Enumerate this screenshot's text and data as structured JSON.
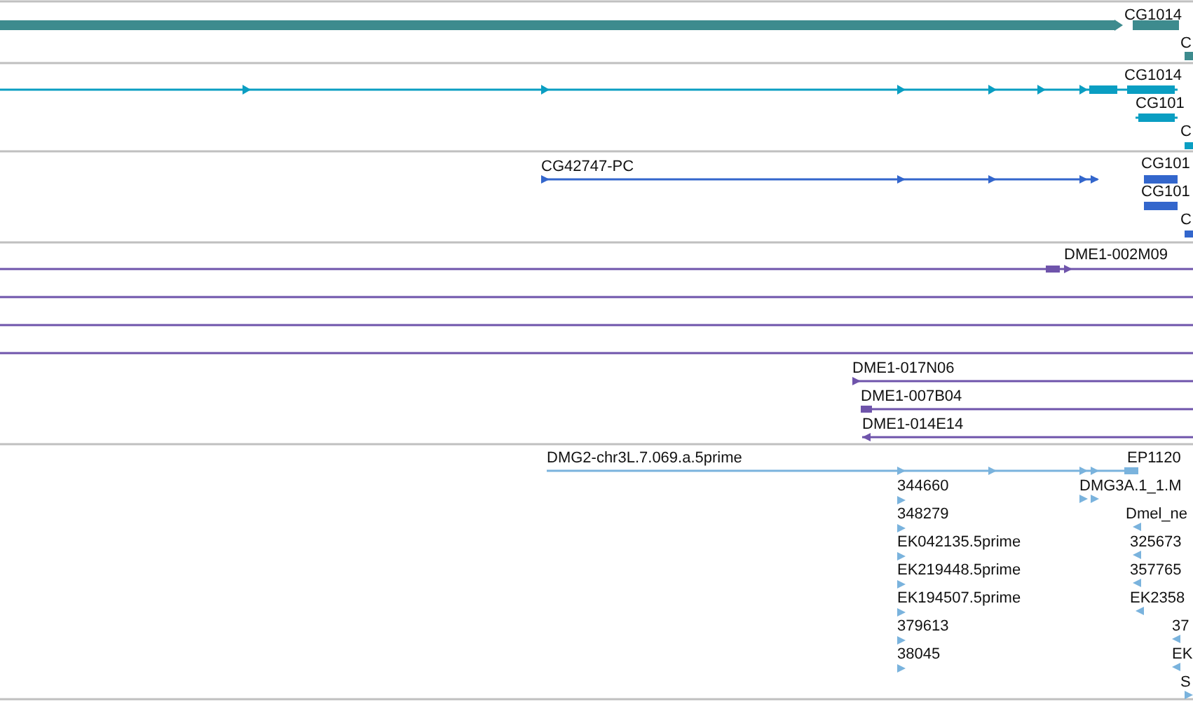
{
  "tracks": [
    {
      "color": "#3d8b8e",
      "features": [
        {
          "label": "CG1014"
        },
        {
          "label": "C"
        }
      ]
    },
    {
      "color": "#0a9ec2",
      "features": [
        {
          "label": "CG1014"
        },
        {
          "label": "CG101"
        },
        {
          "label": "C"
        }
      ]
    },
    {
      "color": "#3366cc",
      "features": [
        {
          "label": "CG42747-PC"
        },
        {
          "label": "CG101"
        },
        {
          "label": "CG101"
        },
        {
          "label": "C"
        }
      ]
    },
    {
      "color": "#6f54ab",
      "features": [
        {
          "kind": "clone",
          "label": "DME1-002M09"
        },
        {
          "kind": "line"
        },
        {
          "kind": "line"
        },
        {
          "kind": "line"
        },
        {
          "kind": "clone",
          "label": "DME1-017N06"
        },
        {
          "kind": "clone",
          "label": "DME1-007B04"
        },
        {
          "kind": "clone",
          "label": "DME1-014E14"
        }
      ]
    },
    {
      "color": "#7ab3dd",
      "features": [
        {
          "label": "DMG2-chr3L.7.069.a.5prime"
        },
        {
          "label": "EP1120"
        },
        {
          "label": "344660"
        },
        {
          "label": "348279"
        },
        {
          "label": "EK042135.5prime"
        },
        {
          "label": "EK219448.5prime"
        },
        {
          "label": "EK194507.5prime"
        },
        {
          "label": "379613"
        },
        {
          "label": "38045"
        },
        {
          "label": "DMG3A.1_1.M"
        },
        {
          "label": "Dmel_ne"
        },
        {
          "label": "325673"
        },
        {
          "label": "357765"
        },
        {
          "label": "EK2358"
        },
        {
          "label": "37"
        },
        {
          "label": "EK"
        },
        {
          "label": "S"
        }
      ]
    }
  ]
}
